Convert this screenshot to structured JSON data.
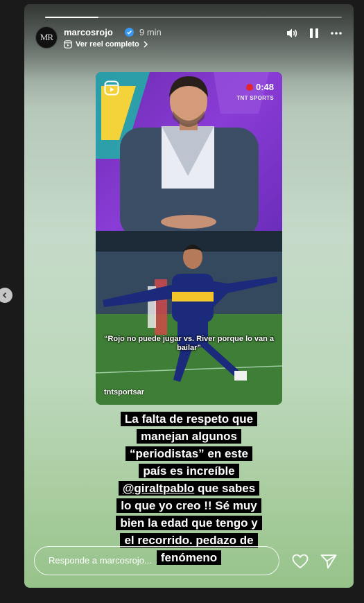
{
  "story": {
    "progress": 0.18,
    "header": {
      "avatar_text": "MR",
      "username": "marcosrojo",
      "time_ago": "9 min",
      "reel_link": "Ver reel completo"
    },
    "media": {
      "timer": "0:48",
      "broadcaster": "TNT SPORTS",
      "quote": "“Rojo no puede jugar vs. River porque lo van a bailar”",
      "watermark": "tntsportsar"
    },
    "caption": {
      "line1": "La falta de respeto que",
      "line2": "manejan algunos",
      "line3": "“periodistas” en este",
      "line4": "país es increíble",
      "mention": "@giraltpablo",
      "line5_rest": " que sabes",
      "line6": "lo que yo creo !! Sé muy",
      "line7": "bien la edad que tengo y",
      "line8": "el recorrido. pedazo de",
      "line9": "fenómeno"
    },
    "reply": {
      "placeholder": "Responde a marcosrojo..."
    }
  },
  "colors": {
    "accent_red": "#e4262c",
    "caption_bg": "#000000"
  },
  "icons": [
    "verified-icon",
    "chevron-right-icon",
    "reel-icon",
    "volume-icon",
    "pause-icon",
    "more-icon",
    "heart-icon",
    "send-icon",
    "chevron-left-icon"
  ]
}
